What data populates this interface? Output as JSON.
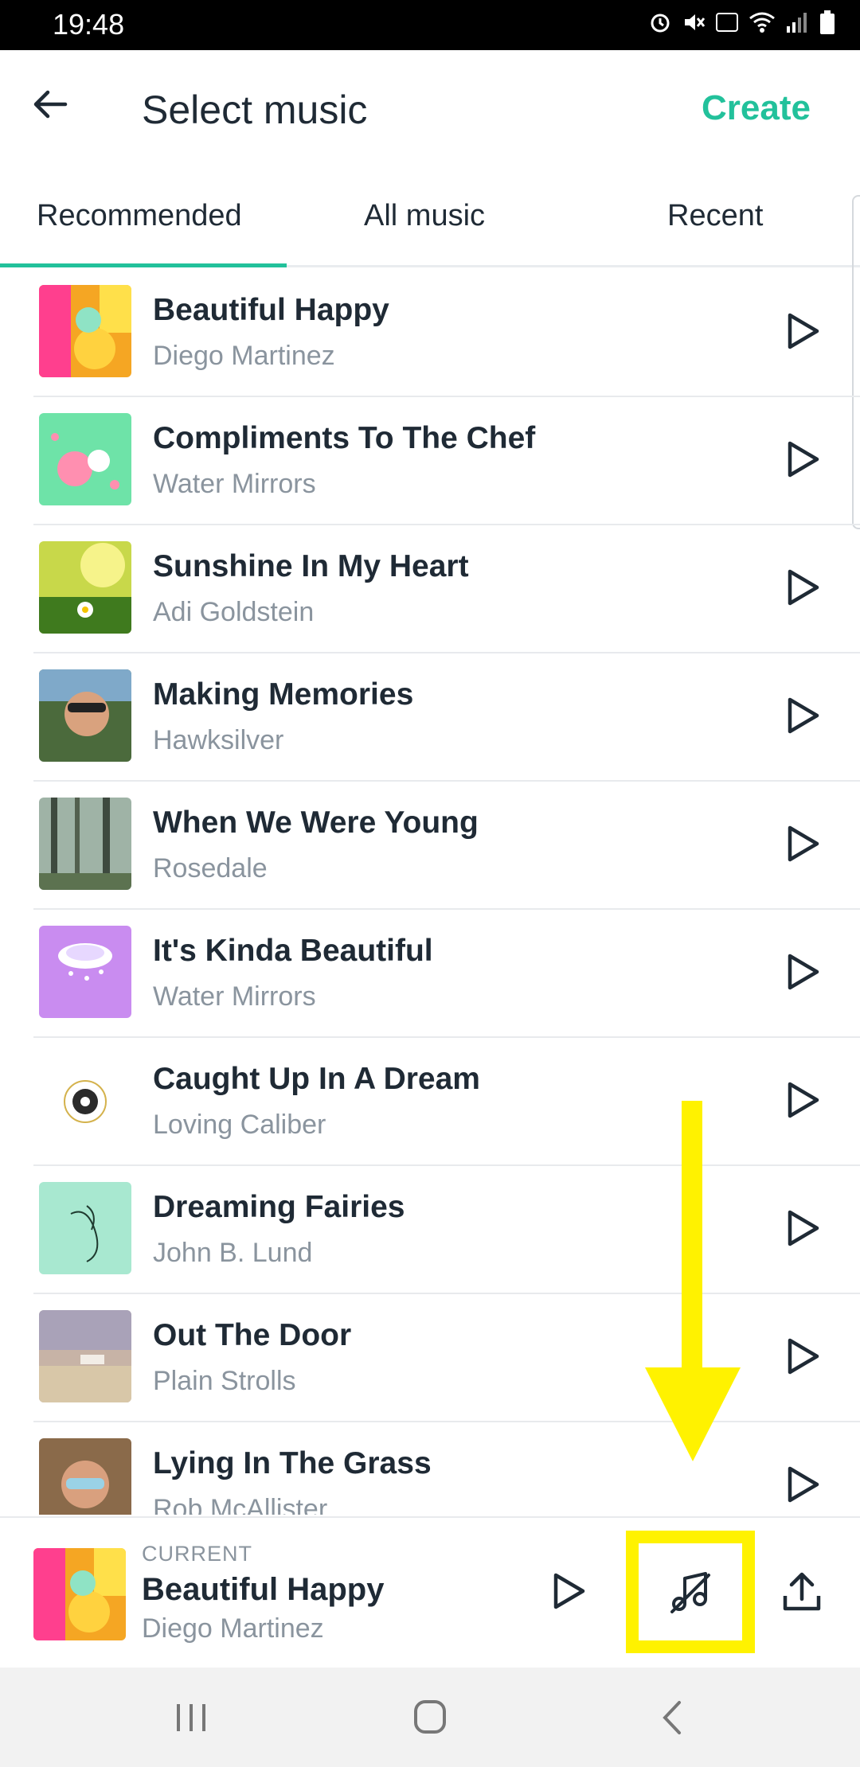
{
  "status_bar": {
    "time": "19:48",
    "icons": [
      "alarm-icon",
      "mute-icon",
      "volte-icon",
      "wifi-icon",
      "signal-icon",
      "battery-icon"
    ]
  },
  "header": {
    "title": "Select music",
    "create_label": "Create",
    "accent": "#22c19b"
  },
  "tabs": [
    {
      "label": "Recommended",
      "active": true
    },
    {
      "label": "All music",
      "active": false
    },
    {
      "label": "Recent",
      "active": false
    }
  ],
  "tracks": [
    {
      "title": "Beautiful Happy",
      "artist": "Diego Martinez"
    },
    {
      "title": "Compliments To The Chef",
      "artist": "Water Mirrors"
    },
    {
      "title": "Sunshine In My Heart",
      "artist": "Adi Goldstein"
    },
    {
      "title": "Making Memories",
      "artist": "Hawksilver"
    },
    {
      "title": "When We Were Young",
      "artist": "Rosedale"
    },
    {
      "title": "It's Kinda Beautiful",
      "artist": "Water Mirrors"
    },
    {
      "title": "Caught Up In A Dream",
      "artist": "Loving Caliber"
    },
    {
      "title": "Dreaming Fairies",
      "artist": "John B. Lund"
    },
    {
      "title": "Out The Door",
      "artist": "Plain Strolls"
    },
    {
      "title": "Lying In The Grass",
      "artist": "Rob McAllister"
    }
  ],
  "player": {
    "current_label": "CURRENT",
    "title": "Beautiful Happy",
    "artist": "Diego Martinez"
  },
  "annotation": {
    "color": "#fff200"
  }
}
